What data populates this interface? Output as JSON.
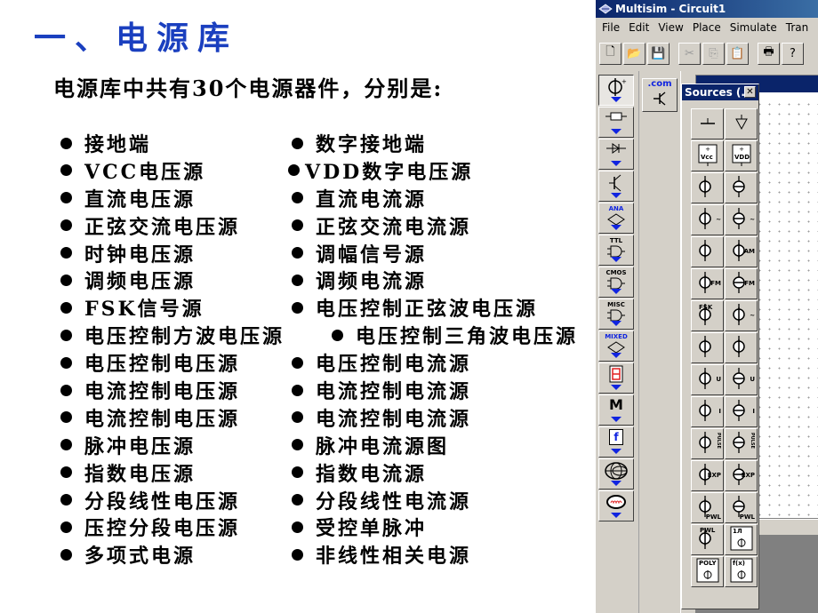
{
  "slide": {
    "title": "一、电源库",
    "subtitle": "电源库中共有30个电源器件，分别是:",
    "title_color": "#1a3fbf",
    "rows": [
      {
        "left": "接地端",
        "right": "数字接地端"
      },
      {
        "left": "VCC电压源",
        "right": "VDD数字电压源"
      },
      {
        "left": "直流电压源",
        "right": "直流电流源"
      },
      {
        "left": "正弦交流电压源",
        "right": "正弦交流电流源"
      },
      {
        "left": "时钟电压源",
        "right": "调幅信号源"
      },
      {
        "left": "调频电压源",
        "right": "调频电流源"
      },
      {
        "left": "FSK信号源",
        "right": "电压控制正弦波电压源"
      },
      {
        "left": "电压控制方波电压源",
        "right": "电压控制三角波电压源"
      },
      {
        "left": "电压控制电压源",
        "right": "电压控制电流源"
      },
      {
        "left": "电流控制电压源",
        "right": "电流控制电流源"
      },
      {
        "left": "电流控制电压源",
        "right": "电流控制电流源"
      },
      {
        "left": "脉冲电压源",
        "right": "脉冲电流源图"
      },
      {
        "left": "指数电压源",
        "right": "指数电流源"
      },
      {
        "left": "分段线性电压源",
        "right": "分段线性电流源"
      },
      {
        "left": "压控分段电压源",
        "right": "受控单脉冲"
      },
      {
        "left": "多项式电源",
        "right": "非线性相关电源"
      }
    ]
  },
  "multisim": {
    "window_title": "Multisim - Circuit1",
    "menu": [
      "File",
      "Edit",
      "View",
      "Place",
      "Simulate",
      "Tran"
    ],
    "toolbar": [
      {
        "icon": "new-file-icon",
        "glyph": "🗋"
      },
      {
        "icon": "open-folder-icon",
        "glyph": "📂"
      },
      {
        "icon": "save-icon",
        "glyph": "💾"
      },
      {
        "icon": "cut-icon",
        "glyph": "✂"
      },
      {
        "icon": "copy-icon",
        "glyph": "⎘"
      },
      {
        "icon": "paste-icon",
        "glyph": "📋"
      },
      {
        "icon": "print-icon",
        "glyph": "🖶"
      },
      {
        "icon": "help-icon",
        "glyph": "?"
      }
    ],
    "component_bar": [
      {
        "name": "sources",
        "label": ""
      },
      {
        "name": "basic",
        "label": ""
      },
      {
        "name": "diodes",
        "label": ""
      },
      {
        "name": "transistors",
        "label": ""
      },
      {
        "name": "analog",
        "label": "ANA"
      },
      {
        "name": "ttl",
        "label": "TTL"
      },
      {
        "name": "cmos",
        "label": "CMOS"
      },
      {
        "name": "misc-digital",
        "label": "MISC"
      },
      {
        "name": "mixed",
        "label": "MIXED"
      },
      {
        "name": "indicators",
        "label": ""
      },
      {
        "name": "misc",
        "label": "M"
      },
      {
        "name": "controls",
        "label": "f"
      },
      {
        "name": "rf",
        "label": ""
      },
      {
        "name": "electromechanical",
        "label": ""
      }
    ],
    "com_button_label": ".com",
    "palette": {
      "title": "Sources (...",
      "close_glyph": "✕",
      "items": [
        {
          "name": "ground",
          "text": ""
        },
        {
          "name": "digital-ground",
          "text": ""
        },
        {
          "name": "vcc-source",
          "text": "Vcc"
        },
        {
          "name": "vdd-source",
          "text": "VDD"
        },
        {
          "name": "dc-voltage-source",
          "text": ""
        },
        {
          "name": "dc-current-source",
          "text": ""
        },
        {
          "name": "ac-voltage-source",
          "text": "~"
        },
        {
          "name": "ac-current-source",
          "text": "~"
        },
        {
          "name": "clock-source",
          "text": ""
        },
        {
          "name": "am-source",
          "text": "AM"
        },
        {
          "name": "fm-voltage-source",
          "text": "FM"
        },
        {
          "name": "fm-current-source",
          "text": "FM"
        },
        {
          "name": "fsk-source",
          "text": "FSK"
        },
        {
          "name": "vc-sine-source",
          "text": "~"
        },
        {
          "name": "vc-square-source",
          "text": ""
        },
        {
          "name": "vc-triangle-source",
          "text": ""
        },
        {
          "name": "vcvs",
          "text": "U"
        },
        {
          "name": "vccs",
          "text": "U"
        },
        {
          "name": "ccvs",
          "text": "I"
        },
        {
          "name": "cccs",
          "text": "I"
        },
        {
          "name": "pulse-voltage-source",
          "text": "PULSE"
        },
        {
          "name": "pulse-current-source",
          "text": "PULSE"
        },
        {
          "name": "exp-voltage-source",
          "text": "EXP"
        },
        {
          "name": "exp-current-source",
          "text": "EXP"
        },
        {
          "name": "pwl-voltage-source",
          "text": "PWL"
        },
        {
          "name": "pwl-current-source",
          "text": "PWL"
        },
        {
          "name": "vc-pwl-source",
          "text": "PWL"
        },
        {
          "name": "controlled-one-shot",
          "text": "1Л"
        },
        {
          "name": "polynomial-source",
          "text": "POLY"
        },
        {
          "name": "nonlinear-dependent-source",
          "text": "f(x)"
        }
      ]
    }
  }
}
